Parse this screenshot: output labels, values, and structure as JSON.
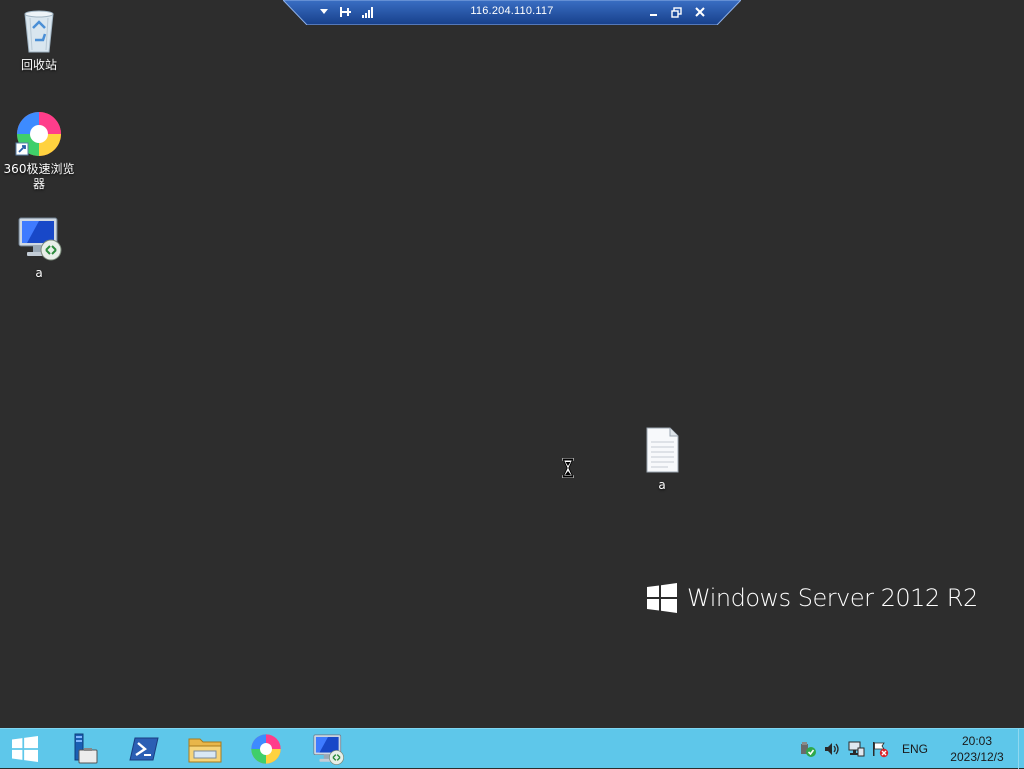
{
  "rdp_bar": {
    "title": "116.204.110.117",
    "pin_icon": "pin-icon",
    "signal_icon": "signal-icon",
    "dropdown_icon": "chevron-down-icon",
    "minimize_icon": "minimize-icon",
    "restore_icon": "restore-icon",
    "close_icon": "close-icon"
  },
  "desktop": {
    "icons": [
      {
        "label": "回收站",
        "icon": "recycle-bin-icon"
      },
      {
        "label": "360极速浏览器",
        "icon": "browser-360-icon"
      },
      {
        "label": "a",
        "icon": "remote-desktop-icon"
      },
      {
        "label": "a",
        "icon": "text-file-icon"
      }
    ],
    "branding": "Windows Server 2012 R2",
    "cursor": "busy-cursor-icon"
  },
  "taskbar": {
    "buttons": [
      {
        "name": "start",
        "icon": "windows-logo-icon"
      },
      {
        "name": "server-manager",
        "icon": "server-manager-icon"
      },
      {
        "name": "powershell",
        "icon": "powershell-icon"
      },
      {
        "name": "file-explorer",
        "icon": "folder-icon"
      },
      {
        "name": "360-browser",
        "icon": "browser-360-icon"
      },
      {
        "name": "remote-desktop",
        "icon": "remote-desktop-icon"
      }
    ],
    "tray": {
      "icons": [
        "security-icon",
        "volume-icon",
        "network-icon",
        "action-center-flag-icon"
      ],
      "language": "ENG",
      "time": "20:03",
      "date": "2023/12/3"
    },
    "background_color": "#5ec7ea"
  },
  "colors": {
    "desktop_background": "#2d2d2d",
    "rdp_bar": "#1f4e9e"
  }
}
